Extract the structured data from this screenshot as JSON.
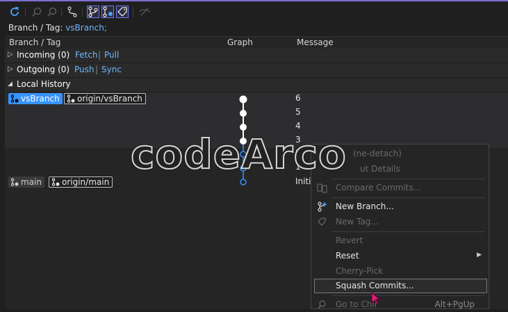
{
  "branch_line": {
    "label": "Branch / Tag:",
    "value": "vsBranch;"
  },
  "header": {
    "branch_tag": "Branch / Tag",
    "graph": "Graph",
    "message": "Message"
  },
  "incoming": {
    "title": "Incoming (0)",
    "fetch": "Fetch",
    "pull": "Pull"
  },
  "outgoing": {
    "title": "Outgoing (0)",
    "push": "Push",
    "sync": "Sync"
  },
  "local_history": {
    "title": "Local History"
  },
  "tags": {
    "vsbranch": "vsBranch",
    "origin_vsbranch": "origin/vsBranch",
    "main": "main",
    "origin_main": "origin/main"
  },
  "commits": [
    {
      "message": "6"
    },
    {
      "message": "5"
    },
    {
      "message": "4"
    },
    {
      "message": "3"
    },
    {
      "message": "2"
    },
    {
      "message": "1"
    },
    {
      "message": "Initia"
    }
  ],
  "context_menu": {
    "items": [
      {
        "label": "(ne-detach)",
        "disabled": true
      },
      {
        "label": "ut Details",
        "disabled": true
      },
      {
        "label": "Compare Commits...",
        "disabled": true
      },
      {
        "label": "New Branch...",
        "disabled": false
      },
      {
        "label": "New Tag...",
        "disabled": true
      },
      {
        "label": "Revert",
        "disabled": true
      },
      {
        "label": "Reset",
        "disabled": false
      },
      {
        "label": "Cherry-Pick",
        "disabled": true
      },
      {
        "label": "Squash Commits...",
        "disabled": false
      },
      {
        "label": "Go to Chil",
        "disabled": true,
        "shortcut": "Alt+PgUp"
      }
    ]
  },
  "watermark": "codeArco",
  "colors": {
    "accent": "#7f6fd1",
    "link": "#6fb7ff",
    "selection": "#3794ff"
  }
}
